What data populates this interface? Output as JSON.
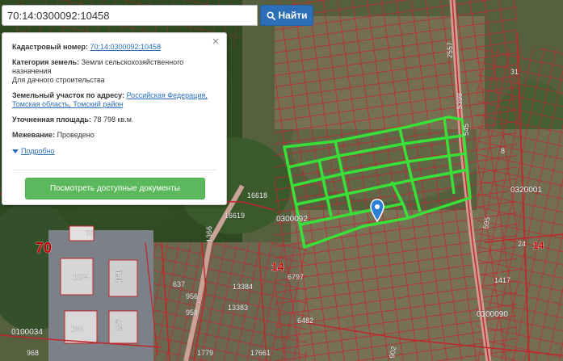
{
  "search": {
    "value": "70:14:0300092:10458",
    "button_label": "Найти"
  },
  "info": {
    "cadastral_label": "Кадастровый номер:",
    "cadastral_value": "70:14:0300092:10458",
    "category_label": "Категория земель:",
    "category_value": "Земли сельскохозяйственного назначения",
    "use_value": "Для дачного строительства",
    "address_label": "Земельный участок по адресу:",
    "address_value": "Российская Федерация, Томская область, Томский район",
    "area_label": "Уточненная площадь:",
    "area_value": "78 798 кв.м.",
    "survey_label": "Межевание:",
    "survey_value": "Проведено",
    "details_label": "Подробно",
    "docs_button": "Посмотреть доступные документы",
    "close_glyph": "×"
  },
  "map": {
    "labels": {
      "l16618": "16618",
      "l16619": "16619",
      "l0300092": "0300092",
      "l14": "14",
      "l70": "70",
      "l1254": "1254",
      "l109": "109",
      "l0100034": "0100034",
      "l968": "968",
      "l2557": "2557",
      "l5398": "5398",
      "l545": "545",
      "l0320001": "0320001",
      "l1417": "1417",
      "l0300090": "0300090",
      "l6797": "6797",
      "l13384": "13384",
      "l13383": "13383",
      "l17661": "17661",
      "l24": "24",
      "l14b": "14",
      "l75": "75",
      "l1366": "1366",
      "l8": "8",
      "l595": "595",
      "l31": "31",
      "l6482": "6482",
      "l902": "902",
      "l1779": "1779",
      "l207": "207",
      "l161": "161",
      "l956": "956",
      "l958": "958",
      "l637": "637"
    },
    "colors": {
      "boundary": "#c0262b",
      "highlight": "#39e039",
      "marker": "#2c7fd6"
    }
  }
}
